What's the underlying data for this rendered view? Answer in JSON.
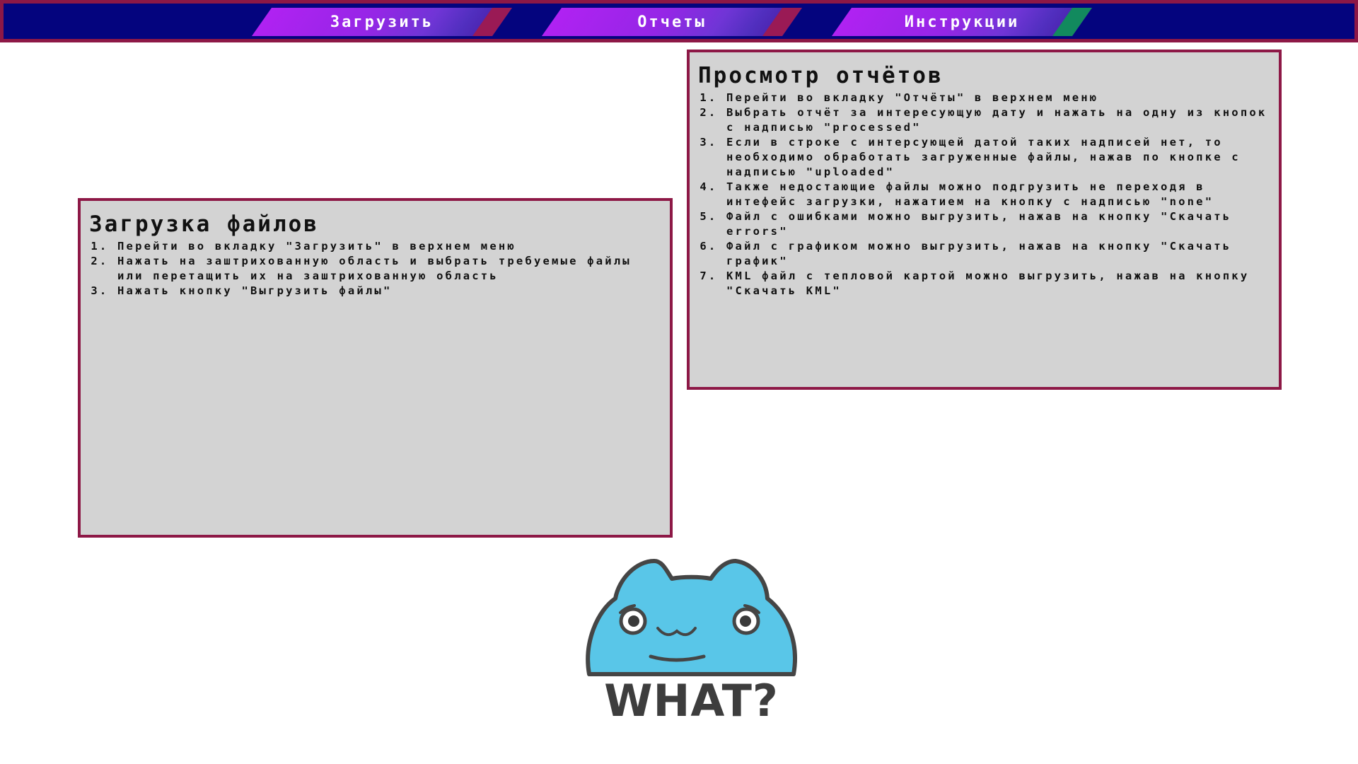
{
  "nav": {
    "tabs": [
      {
        "label": "Загрузить",
        "stripe_color": "#9a1a55"
      },
      {
        "label": "Отчеты",
        "stripe_color": "#9a1a55"
      },
      {
        "label": "Инструкции",
        "stripe_color": "#128a5e"
      }
    ]
  },
  "upload_panel": {
    "title": "Загрузка файлов",
    "steps": [
      "Перейти во вкладку \"Загрузить\" в верхнем меню",
      "Нажать на заштрихованную область и выбрать требуемые файлы или перетащить их на заштрихованную область",
      "Нажать кнопку \"Выгрузить файлы\""
    ]
  },
  "reports_panel": {
    "title": "Просмотр отчётов",
    "steps": [
      "Перейти во вкладку \"Отчёты\" в верхнем меню",
      "Выбрать отчёт за интересующую дату и нажать на одну из кнопок с надписью \"processed\"",
      "Если в строке с интерсующей датой таких надписей нет, то необходимо обработать загруженные файлы, нажав по кнопке с надписью \"uploaded\"",
      "Также недостающие файлы можно подгрузить не переходя в интефейс загрузки, нажатием на кнопку с надписью \"none\"",
      "Файл с ошибками можно выгрузить, нажав на кнопку \"Скачать errors\"",
      "Файл с графиком можно выгрузить, нажав на кнопку \"Скачать график\"",
      "KML файл с тепловой картой можно выгрузить, нажав на кнопку \"Скачать KML\""
    ]
  },
  "mascot": {
    "caption": "WHAT?",
    "body_color": "#59c6e8"
  }
}
